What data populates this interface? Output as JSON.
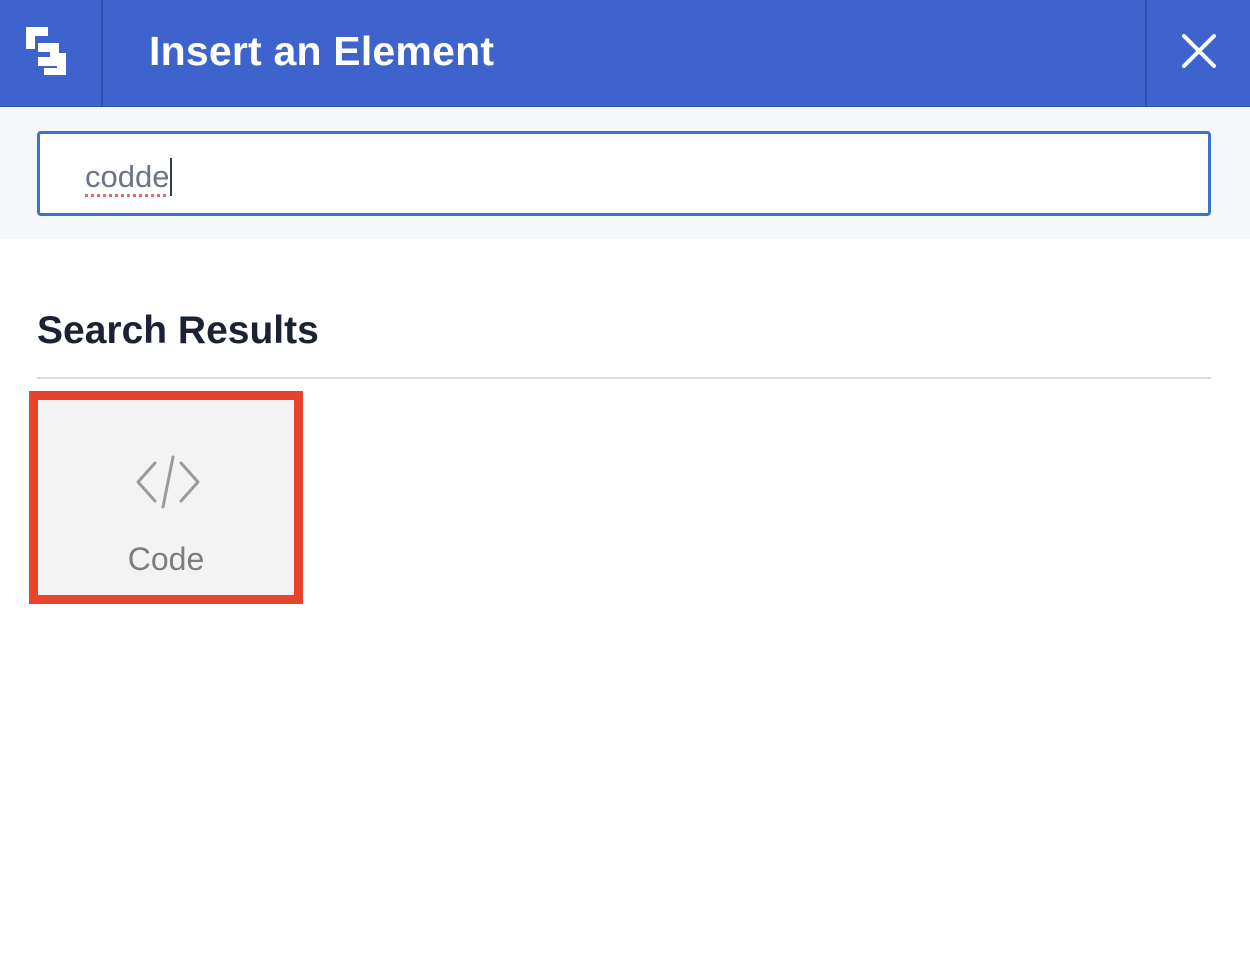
{
  "dialog": {
    "title": "Insert an Element",
    "logo_icon": "builder-logo-icon",
    "close_icon": "close-icon"
  },
  "search": {
    "value": "codde",
    "spellcheck_flag": true
  },
  "results": {
    "heading": "Search Results",
    "items": [
      {
        "label": "Code",
        "icon": "code-icon",
        "highlighted": true
      }
    ]
  },
  "colors": {
    "header_bg": "#3e63cc",
    "input_border": "#3e72cc",
    "highlight": "#e8442c"
  }
}
